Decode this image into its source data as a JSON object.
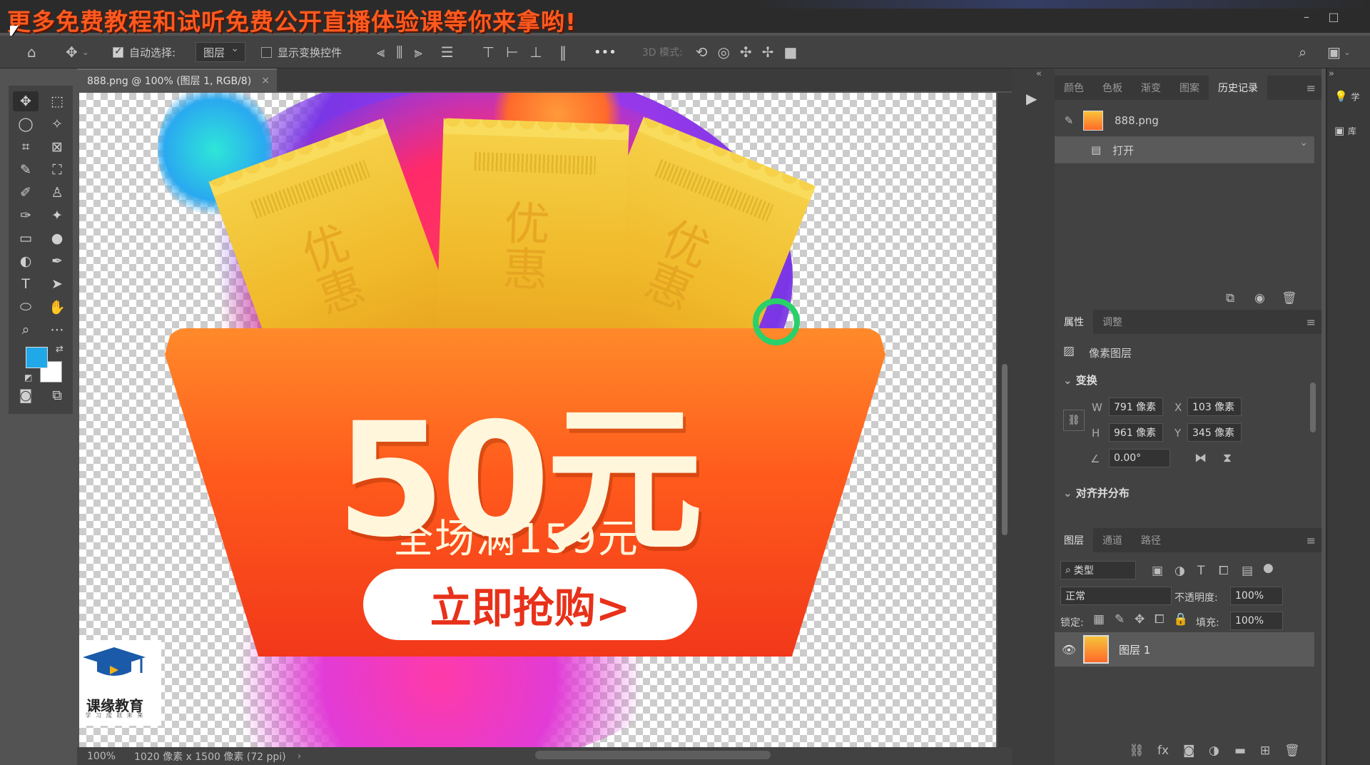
{
  "banner": {
    "text": "更多免费教程和试听免费公开直播体验课等你来拿哟!"
  },
  "window": {
    "minimize": "–",
    "restore": "□"
  },
  "optbar": {
    "home_icon": "home-icon",
    "move_icon": "move-icon",
    "auto_select_label": "自动选择:",
    "auto_select_checked": true,
    "auto_select_target": "图层",
    "show_transform_label": "显示变换控件",
    "more": "•••",
    "mode_3d_label": "3D 模式:"
  },
  "document": {
    "tab_title": "888.png @ 100% (图层 1, RGB/8)",
    "tab_close": "×"
  },
  "artwork": {
    "ticket_text": "优惠",
    "amount": "50元",
    "subtitle": "全场满159元",
    "cta": "立即抢购>",
    "logo_name": "课缘教育",
    "logo_small": "学 习 成 就 未 来"
  },
  "status": {
    "zoom": "100%",
    "info": "1020 像素 x 1500 像素 (72 ppi)",
    "arrow": "›"
  },
  "panels": {
    "top_tabs": [
      "颜色",
      "色板",
      "渐变",
      "图案",
      "历史记录"
    ],
    "top_active": 4,
    "history": {
      "snapshot": "888.png",
      "steps": [
        "打开"
      ]
    },
    "props_tabs": [
      "属性",
      "调整"
    ],
    "props_active": 0,
    "props": {
      "layer_kind": "像素图层",
      "transform_title": "变换",
      "w_label": "W",
      "w": "791 像素",
      "x_label": "X",
      "x": "103 像素",
      "h_label": "H",
      "h": "961 像素",
      "y_label": "Y",
      "y": "345 像素",
      "angle": "0.00°",
      "align_title": "对齐并分布"
    },
    "layers_tabs": [
      "图层",
      "通道",
      "路径"
    ],
    "layers_active": 0,
    "layers": {
      "filter_kind": "类型",
      "blend_mode": "正常",
      "opacity_label": "不透明度:",
      "opacity": "100%",
      "lock_label": "锁定:",
      "fill_label": "填充:",
      "fill": "100%",
      "items": [
        {
          "name": "图层 1",
          "visible": true
        }
      ]
    },
    "side_learn": "学",
    "side_lib": "库"
  },
  "colors": {
    "foreground": "#20a8e8",
    "background": "#ffffff",
    "accent": "#2ad06a"
  }
}
